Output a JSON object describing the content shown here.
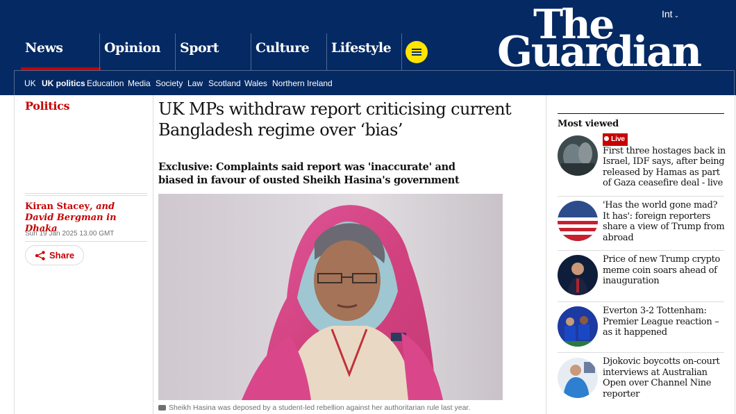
{
  "header": {
    "edition": "Int",
    "logo_line1": "The",
    "logo_line2": "Guardian",
    "pillars": [
      "News",
      "Opinion",
      "Sport",
      "Culture",
      "Lifestyle"
    ],
    "subnav": [
      "UK",
      "UK politics",
      "Education",
      "Media",
      "Society",
      "Law",
      "Scotland",
      "Wales",
      "Northern Ireland"
    ],
    "active_subnav": "UK politics",
    "colors": {
      "brand_blue": "#052962",
      "news_red": "#c70000",
      "menu_yellow": "#ffe500"
    }
  },
  "article": {
    "section": "Politics",
    "byline_author1": "Kiran Stacey",
    "byline_and": ", and David Bergman in Dhaka",
    "date": "Sun 19 Jan 2025 13.00 GMT",
    "share_label": "Share",
    "headline": "UK MPs withdraw report criticising current Bangladesh regime over ‘bias’",
    "standfirst": "Exclusive: Complaints said report was 'inaccurate' and biased in favour of ousted Sheikh Hasina's government",
    "caption": "Sheikh Hasina was deposed by a student-led rebellion against her authoritarian rule last year."
  },
  "most_viewed": {
    "title": "Most viewed",
    "live_label": "Live",
    "items": [
      {
        "text": "First three hostages back in Israel, IDF says, after being released by Hamas as part of Gaza ceasefire deal - live",
        "live": true
      },
      {
        "text": "'Has the world gone mad? It has': foreign reporters share a view of Trump from abroad",
        "live": false
      },
      {
        "text": "Price of new Trump crypto meme coin soars ahead of inauguration",
        "live": false
      },
      {
        "text": "Everton 3-2 Tottenham: Premier League reaction – as it happened",
        "live": false
      },
      {
        "text": "Djokovic boycotts on-court interviews at Australian Open over Channel Nine reporter",
        "live": false
      }
    ]
  }
}
